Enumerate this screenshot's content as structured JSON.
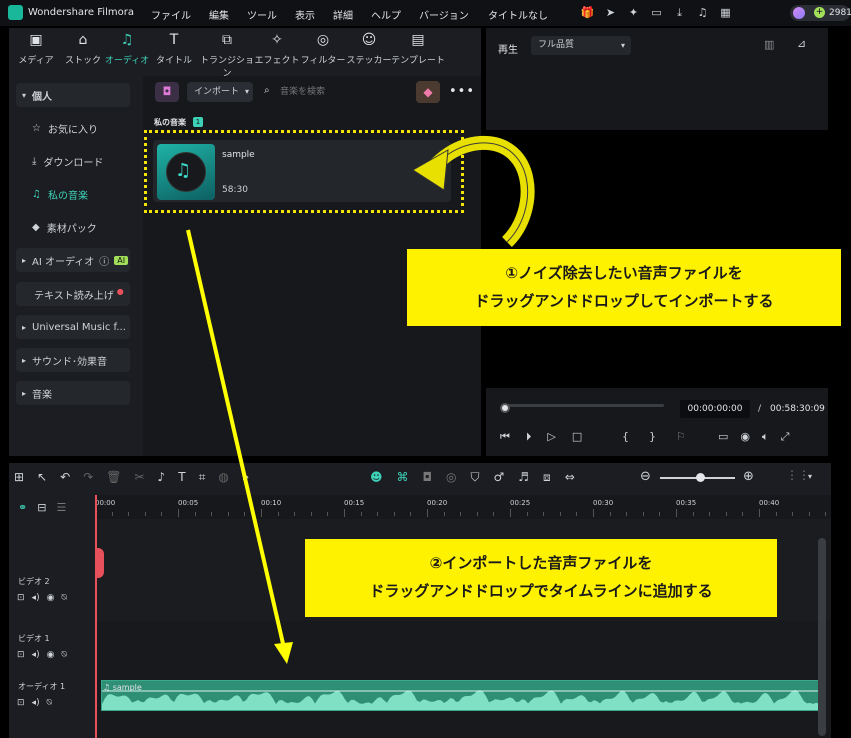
{
  "app": {
    "name": "Wondershare Filmora",
    "doc_title": "タイトルなし",
    "credits": "2981"
  },
  "menu": [
    "ファイル",
    "編集",
    "ツール",
    "表示",
    "詳細",
    "ヘルプ",
    "バージョン"
  ],
  "media_tabs": [
    {
      "label": "メディア",
      "icon": "media-icon"
    },
    {
      "label": "ストック",
      "icon": "stock-icon"
    },
    {
      "label": "オーディオ",
      "icon": "music-note-icon",
      "active": true
    },
    {
      "label": "タイトル",
      "icon": "title-icon"
    },
    {
      "label": "トランジション",
      "icon": "transition-icon"
    },
    {
      "label": "エフェクト",
      "icon": "effect-icon"
    },
    {
      "label": "フィルター",
      "icon": "filter-icon"
    },
    {
      "label": "ステッカー",
      "icon": "sticker-icon"
    },
    {
      "label": "テンプレート",
      "icon": "template-icon"
    }
  ],
  "sidebar": {
    "personal": "個人",
    "items": [
      "お気に入り",
      "ダウンロード",
      "私の音楽",
      "素材パック"
    ],
    "ai_audio": "AI オーディオ",
    "ai_badge": "AI",
    "tts": "テキスト読み上げ",
    "universal": "Universal Music f...",
    "sfx": "サウンド･効果音",
    "music": "音楽"
  },
  "content": {
    "import_label": "インポート",
    "search_placeholder": "音楽を検索",
    "section_title": "私の音楽",
    "section_count": "1",
    "file_name": "sample",
    "file_duration": "58:30"
  },
  "player": {
    "tab_label": "再生",
    "quality": "フル品質",
    "current_time": "00:00:00:00",
    "separator": "/",
    "total_time": "00:58:30:09",
    "progress": 0
  },
  "timeline": {
    "ticks": [
      "00:00",
      "00:05",
      "00:10",
      "00:15",
      "00:20",
      "00:25",
      "00:30",
      "00:35",
      "00:40"
    ],
    "tracks": [
      {
        "label": "ビデオ 2"
      },
      {
        "label": "ビデオ 1"
      },
      {
        "label": "オーディオ 1"
      }
    ],
    "clip_label": "sample"
  },
  "annotations": {
    "callout1_line1": "①ノイズ除去したい音声ファイルを",
    "callout1_line2": "ドラッグアンドドロップしてインポートする",
    "callout2_line1": "②インポートした音声ファイルを",
    "callout2_line2": "ドラッグアンドドロップでタイムラインに追加する"
  },
  "colors": {
    "accent": "#3dd2b7",
    "callout": "#fff200",
    "audio_clip": "#2f8f75",
    "playhead": "#e8505b"
  }
}
